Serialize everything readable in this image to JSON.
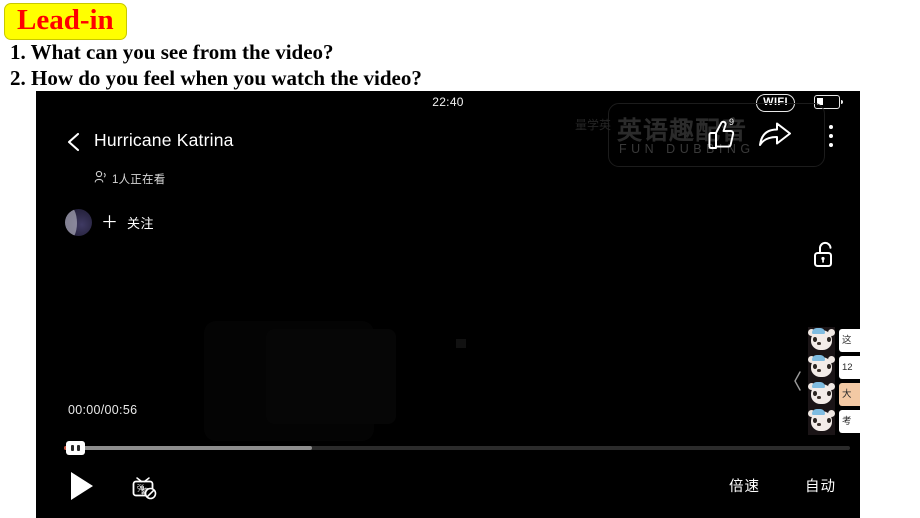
{
  "slide": {
    "badge_label": "Lead-in",
    "badge_bg": "#ffff00",
    "badge_color": "#ff0000",
    "questions": [
      "1. What can you see from the video?",
      "2. How do you feel when you watch the video?"
    ]
  },
  "player": {
    "status_bar": {
      "time": "22:40",
      "wifi_label": "WIFI",
      "battery_icon": "battery-low-icon"
    },
    "nav": {
      "back_icon": "back-chevron-icon",
      "title": "Hurricane Katrina",
      "viewer_icon": "viewer-head-icon",
      "viewer_count_label": "1人正在看"
    },
    "watermark": {
      "cn_text": "英语趣配音",
      "cn_small_text": "量学英",
      "en_text": "FUN DUBBING"
    },
    "actions": {
      "like_icon": "thumbs-up-icon",
      "like_count": "9",
      "share_icon": "share-arrow-icon",
      "more_icon": "more-vertical-icon"
    },
    "follow": {
      "avatar_icon": "user-avatar",
      "plus_label": "＋",
      "follow_label": "关注"
    },
    "lock": {
      "icon": "unlock-icon"
    },
    "side_panel": {
      "collapse_icon": "chevron-left-icon",
      "items": [
        {
          "avatar_icon": "panda-avatar",
          "text": "这"
        },
        {
          "avatar_icon": "panda-avatar",
          "text": "12"
        },
        {
          "avatar_icon": "panda-avatar",
          "text": "大"
        },
        {
          "avatar_icon": "panda-avatar",
          "text": "考"
        }
      ]
    },
    "progress": {
      "time_display": "00:00/00:56",
      "current_time": "00:00",
      "duration": "00:56",
      "played_percent": 0.6,
      "buffered_percent": 31.5,
      "thumb_icon": "scrubber-handle"
    },
    "controls": {
      "play_icon": "play-icon",
      "danmaku_icon": "danmaku-off-icon",
      "speed_label": "倍速",
      "quality_label": "自动"
    }
  }
}
